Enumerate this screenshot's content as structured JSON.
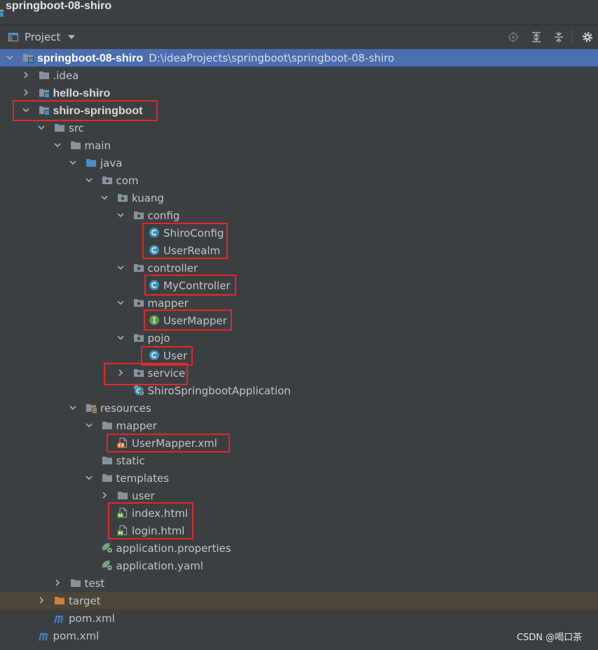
{
  "window": {
    "title": "springboot-08-shiro",
    "icon": "module-icon"
  },
  "toolbar": {
    "view_icon": "project-view-icon",
    "view_label": "Project",
    "dropdown_icon": "dropdown-arrow-icon",
    "action_icons": [
      "locate-icon",
      "expand-all-icon",
      "collapse-all-icon",
      "gear-icon"
    ]
  },
  "colors": {
    "panel_background": "#3c3f41",
    "selected_row": "#4b6eaf",
    "excluded_row": "#4a4536",
    "highlight_box": "#e2282c"
  },
  "tree": {
    "rows": [
      {
        "label": "springboot-08-shiro",
        "path": "D:\\ideaProjects\\springboot\\springboot-08-shiro",
        "depth": 0,
        "expanded": true,
        "icon": "module-icon",
        "bold": true,
        "selected": true
      },
      {
        "label": ".idea",
        "depth": 1,
        "expanded": false,
        "icon": "folder-icon"
      },
      {
        "label": "hello-shiro",
        "depth": 1,
        "expanded": false,
        "icon": "module-icon",
        "bold": true
      },
      {
        "label": "shiro-springboot",
        "depth": 1,
        "expanded": true,
        "icon": "module-icon",
        "bold": true
      },
      {
        "label": "src",
        "depth": 2,
        "expanded": true,
        "icon": "folder-icon"
      },
      {
        "label": "main",
        "depth": 3,
        "expanded": true,
        "icon": "folder-icon"
      },
      {
        "label": "java",
        "depth": 4,
        "expanded": true,
        "icon": "source-folder-icon"
      },
      {
        "label": "com",
        "depth": 5,
        "expanded": true,
        "icon": "package-icon"
      },
      {
        "label": "kuang",
        "depth": 6,
        "expanded": true,
        "icon": "package-icon"
      },
      {
        "label": "config",
        "depth": 7,
        "expanded": true,
        "icon": "package-icon"
      },
      {
        "label": "ShiroConfig",
        "depth": 8,
        "icon": "class-icon"
      },
      {
        "label": "UserRealm",
        "depth": 8,
        "icon": "class-icon"
      },
      {
        "label": "controller",
        "depth": 7,
        "expanded": true,
        "icon": "package-icon"
      },
      {
        "label": "MyController",
        "depth": 8,
        "icon": "class-icon"
      },
      {
        "label": "mapper",
        "depth": 7,
        "expanded": true,
        "icon": "package-icon"
      },
      {
        "label": "UserMapper",
        "depth": 8,
        "icon": "interface-icon"
      },
      {
        "label": "pojo",
        "depth": 7,
        "expanded": true,
        "icon": "package-icon"
      },
      {
        "label": "User",
        "depth": 8,
        "icon": "class-icon"
      },
      {
        "label": "service",
        "depth": 7,
        "expanded": false,
        "icon": "package-icon"
      },
      {
        "label": "ShiroSpringbootApplication",
        "depth": 7,
        "icon": "spring-boot-app-icon"
      },
      {
        "label": "resources",
        "depth": 4,
        "expanded": true,
        "icon": "resources-folder-icon"
      },
      {
        "label": "mapper",
        "depth": 5,
        "expanded": true,
        "icon": "folder-icon"
      },
      {
        "label": "UserMapper.xml",
        "depth": 6,
        "icon": "xml-file-icon"
      },
      {
        "label": "static",
        "depth": 5,
        "icon": "folder-icon"
      },
      {
        "label": "templates",
        "depth": 5,
        "expanded": true,
        "icon": "folder-icon"
      },
      {
        "label": "user",
        "depth": 6,
        "expanded": false,
        "icon": "folder-icon"
      },
      {
        "label": "index.html",
        "depth": 6,
        "icon": "html-file-icon"
      },
      {
        "label": "login.html",
        "depth": 6,
        "icon": "html-file-icon"
      },
      {
        "label": "application.properties",
        "depth": 5,
        "icon": "spring-config-icon"
      },
      {
        "label": "application.yaml",
        "depth": 5,
        "icon": "spring-config-icon"
      },
      {
        "label": "test",
        "depth": 3,
        "expanded": false,
        "icon": "folder-icon"
      },
      {
        "label": "target",
        "depth": 2,
        "expanded": false,
        "icon": "excluded-folder-icon",
        "excluded": true
      },
      {
        "label": "pom.xml",
        "depth": 2,
        "icon": "maven-icon"
      },
      {
        "label": "pom.xml",
        "depth": 1,
        "icon": "maven-icon"
      }
    ]
  },
  "watermark": "CSDN @喝口茶"
}
